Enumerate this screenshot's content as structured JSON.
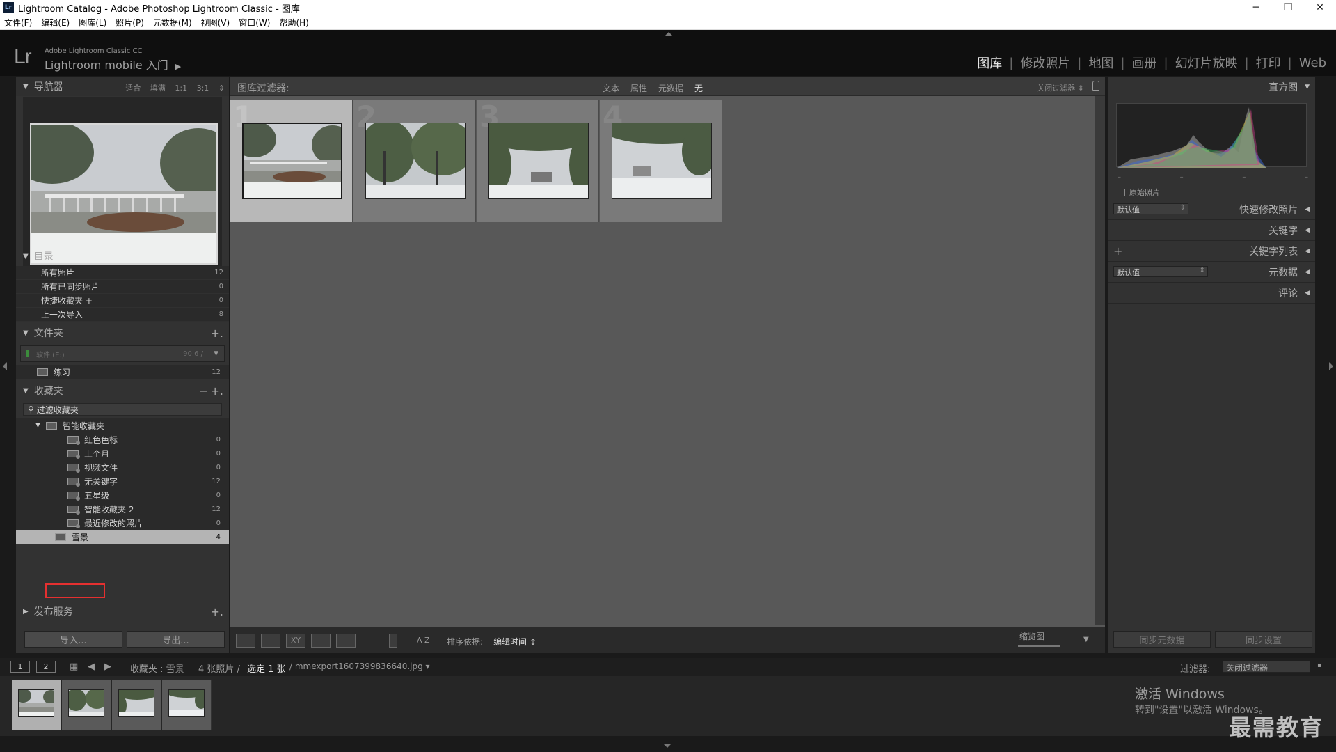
{
  "window": {
    "title": "Lightroom Catalog - Adobe Photoshop Lightroom Classic - 图库",
    "app_icon": "Lr",
    "minimize": "─",
    "maximize": "❐",
    "close": "✕"
  },
  "menu": [
    "文件(F)",
    "编辑(E)",
    "图库(L)",
    "照片(P)",
    "元数据(M)",
    "视图(V)",
    "窗口(W)",
    "帮助(H)"
  ],
  "identity": {
    "logo": "Lr",
    "small": "Adobe Lightroom Classic CC",
    "big": "Lightroom mobile 入门",
    "arrow": "▶"
  },
  "modules": {
    "items": [
      "图库",
      "修改照片",
      "地图",
      "画册",
      "幻灯片放映",
      "打印",
      "Web"
    ],
    "active_index": 0
  },
  "navigator": {
    "title": "导航器",
    "zoom": [
      "适合",
      "填满",
      "1:1",
      "3:1"
    ],
    "zoom_arrow": "⇕"
  },
  "catalog": {
    "title": "目录",
    "items": [
      {
        "label": "所有照片",
        "count": "12"
      },
      {
        "label": "所有已同步照片",
        "count": "0"
      },
      {
        "label": "快捷收藏夹 +",
        "count": "0"
      },
      {
        "label": "上一次导入",
        "count": "8"
      }
    ]
  },
  "folders": {
    "title": "文件夹",
    "add": "+.",
    "volume_name": "软件 (E:)",
    "volume_size": "90.6 /",
    "volume_dropdown": "▼",
    "items": [
      {
        "label": "练习",
        "count": "12"
      }
    ]
  },
  "collections": {
    "title": "收藏夹",
    "minus": "−",
    "add": "+.",
    "filter": "过滤收藏夹",
    "set": "智能收藏夹",
    "items": [
      {
        "label": "红色色标",
        "count": "0"
      },
      {
        "label": "上个月",
        "count": "0"
      },
      {
        "label": "视频文件",
        "count": "0"
      },
      {
        "label": "无关键字",
        "count": "12"
      },
      {
        "label": "五星级",
        "count": "0"
      },
      {
        "label": "智能收藏夹 2",
        "count": "12"
      },
      {
        "label": "最近修改的照片",
        "count": "0"
      }
    ],
    "selected": {
      "label": "雪景",
      "count": "4"
    }
  },
  "publish": {
    "title": "发布服务",
    "add": "+."
  },
  "left_buttons": {
    "import": "导入...",
    "export": "导出..."
  },
  "library_filter": {
    "label": "图库过滤器:",
    "options": [
      "文本",
      "属性",
      "元数据",
      "无"
    ],
    "active": "无",
    "off": "关闭过滤器 ⇕"
  },
  "grid": {
    "cells": [
      {
        "index": "1",
        "selected": true
      },
      {
        "index": "2",
        "selected": false
      },
      {
        "index": "3",
        "selected": false
      },
      {
        "index": "4",
        "selected": false
      }
    ]
  },
  "toolbar": {
    "sort_label": "排序依据:",
    "sort_value": "编辑时间 ⇕",
    "thumb_label": "缩览图",
    "az": "A Z",
    "xy": "XY"
  },
  "right_panel": {
    "histogram": "直方图",
    "histo_ticks": [
      "–",
      "–",
      "–",
      "–"
    ],
    "original": "原始照片",
    "quick_develop": "快速修改照片",
    "keywords": "关键字",
    "keyword_list": "关键字列表",
    "metadata": "元数据",
    "comments": "评论",
    "default_value": "默认值",
    "plus": "+",
    "sync_meta": "同步元数据",
    "sync_settings": "同步设置"
  },
  "filmstrip_bar": {
    "page1": "1",
    "page2": "2",
    "path_prefix": "收藏夹 : 雪景",
    "count": "4 张照片 /",
    "selected": "选定 1 张",
    "file": "/ mmexport1607399836640.jpg ▾",
    "filter_label": "过滤器:",
    "filter_value": "关闭过滤器"
  },
  "watermark": {
    "activate": "激活 Windows",
    "activate_sub": "转到\"设置\"以激活 Windows。",
    "brand": "最需教育"
  },
  "colors": {
    "selection_box": "#e53030",
    "active_module": "#e6e6e6"
  }
}
